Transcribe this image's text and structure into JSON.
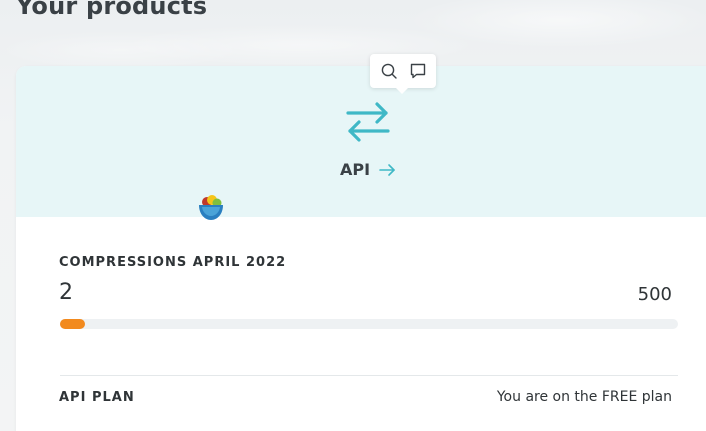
{
  "page": {
    "title": "Your products"
  },
  "product": {
    "name": "API",
    "icon": "transfer-arrows-icon",
    "link_icon": "arrow-right-icon",
    "logo_icon": "bowl-logo-icon",
    "accent_color": "#3fb8c6",
    "header_bg": "#e7f6f7"
  },
  "toolbar": {
    "items": [
      {
        "icon": "search-icon"
      },
      {
        "icon": "comment-icon"
      }
    ]
  },
  "usage": {
    "label": "COMPRESSIONS APRIL 2022",
    "count": "2",
    "limit": "500",
    "progress_fraction": 0.004,
    "bar_color": "#f28a1e"
  },
  "plan": {
    "label": "API PLAN",
    "status": "You are on the FREE plan"
  }
}
